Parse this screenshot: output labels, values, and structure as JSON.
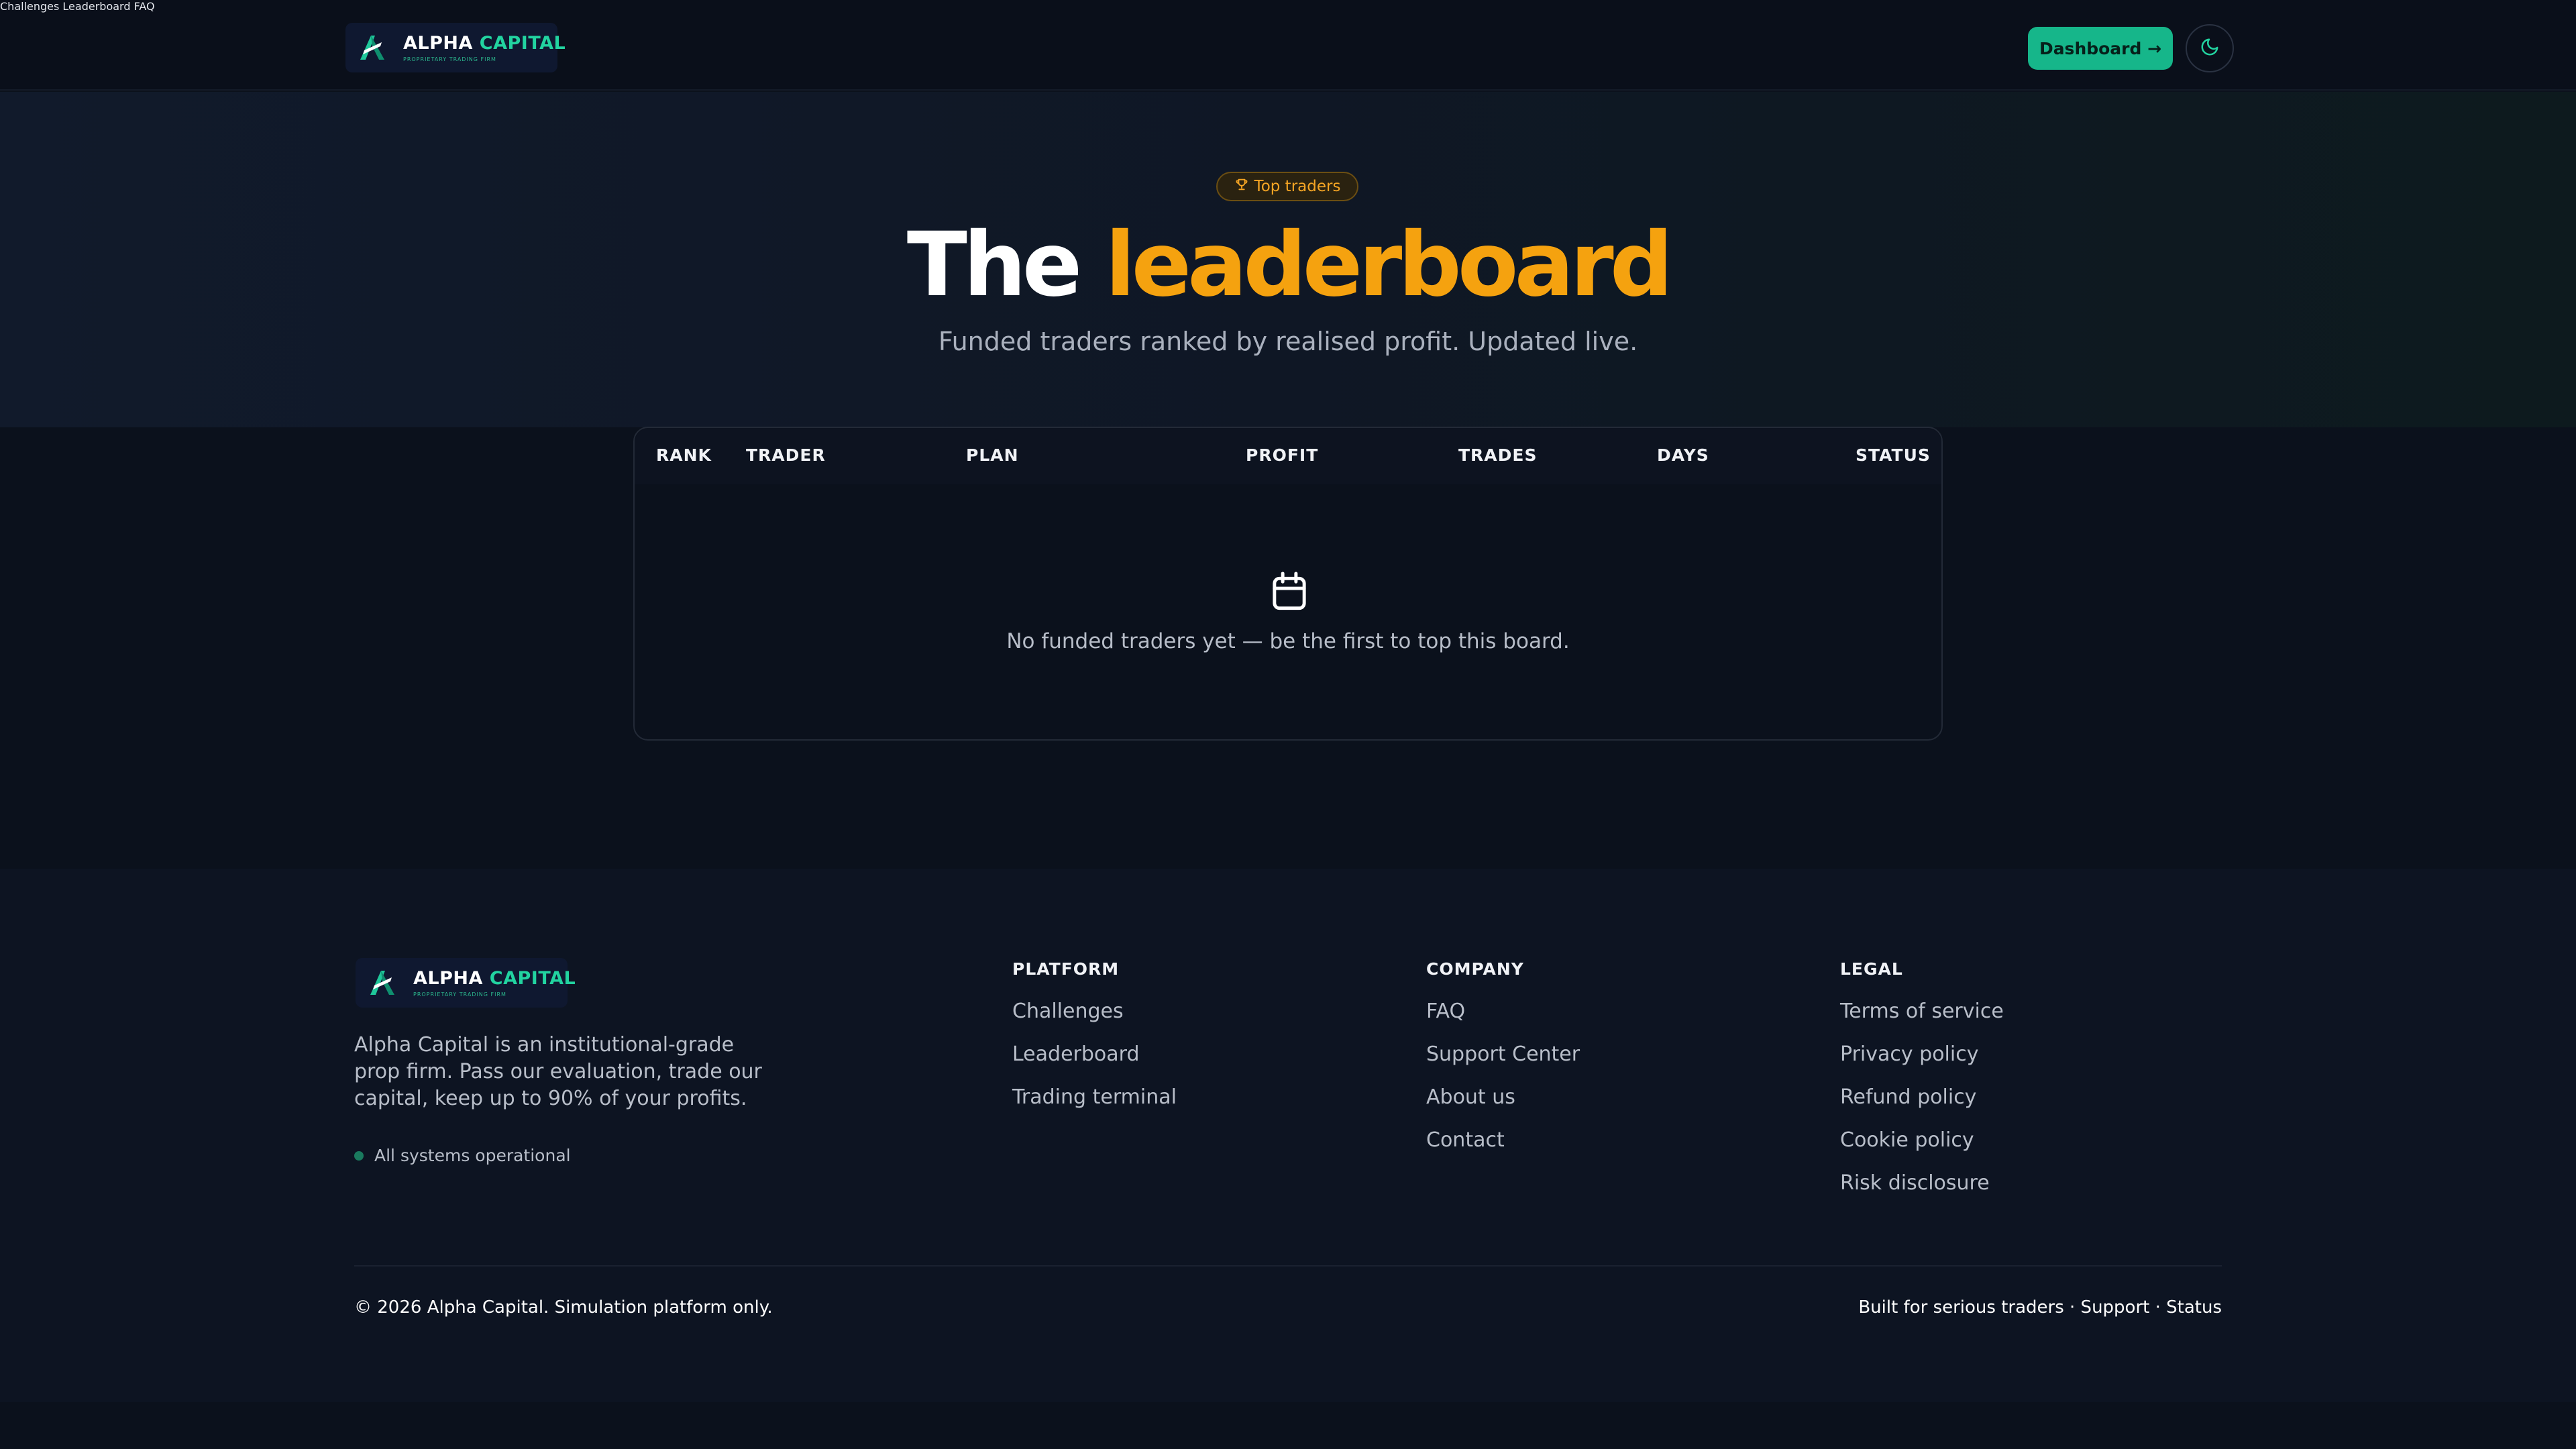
{
  "brand": {
    "name_white": "ALPHA",
    "name_green": "CAPITAL",
    "tagline": "PROPRIETARY TRADING FIRM"
  },
  "nav": {
    "items": [
      "Challenges",
      "Leaderboard",
      "FAQ"
    ],
    "dashboard_label": "Dashboard →"
  },
  "icons": {
    "logo": "alpha-logo-icon",
    "theme": "moon-icon",
    "pill": "trophy-icon",
    "empty": "calendar-icon"
  },
  "hero": {
    "pill_label": "Top traders",
    "title_white": "The",
    "title_orange": "leaderboard",
    "subtitle": "Funded traders ranked by realised profit. Updated live."
  },
  "table": {
    "columns": [
      "RANK",
      "TRADER",
      "PLAN",
      "PROFIT",
      "TRADES",
      "DAYS",
      "STATUS"
    ],
    "rows": [],
    "empty_message": "No funded traders yet — be the first to top this board."
  },
  "footer": {
    "description": "Alpha Capital is an institutional-grade prop firm. Pass our evaluation, trade our capital, keep up to 90% of your profits.",
    "status": "All systems operational",
    "columns": [
      {
        "title": "PLATFORM",
        "links": [
          "Challenges",
          "Leaderboard",
          "Trading terminal"
        ]
      },
      {
        "title": "COMPANY",
        "links": [
          "FAQ",
          "Support Center",
          "About us",
          "Contact"
        ]
      },
      {
        "title": "LEGAL",
        "links": [
          "Terms of service",
          "Privacy policy",
          "Refund policy",
          "Cookie policy",
          "Risk disclosure"
        ]
      }
    ],
    "copyright": "© 2026 Alpha Capital. Simulation platform only.",
    "bottom_links": "Built for serious traders · Support · Status"
  },
  "colors": {
    "accent_green": "#16b68a",
    "accent_orange": "#f5a20f",
    "background": "#0b111c"
  }
}
